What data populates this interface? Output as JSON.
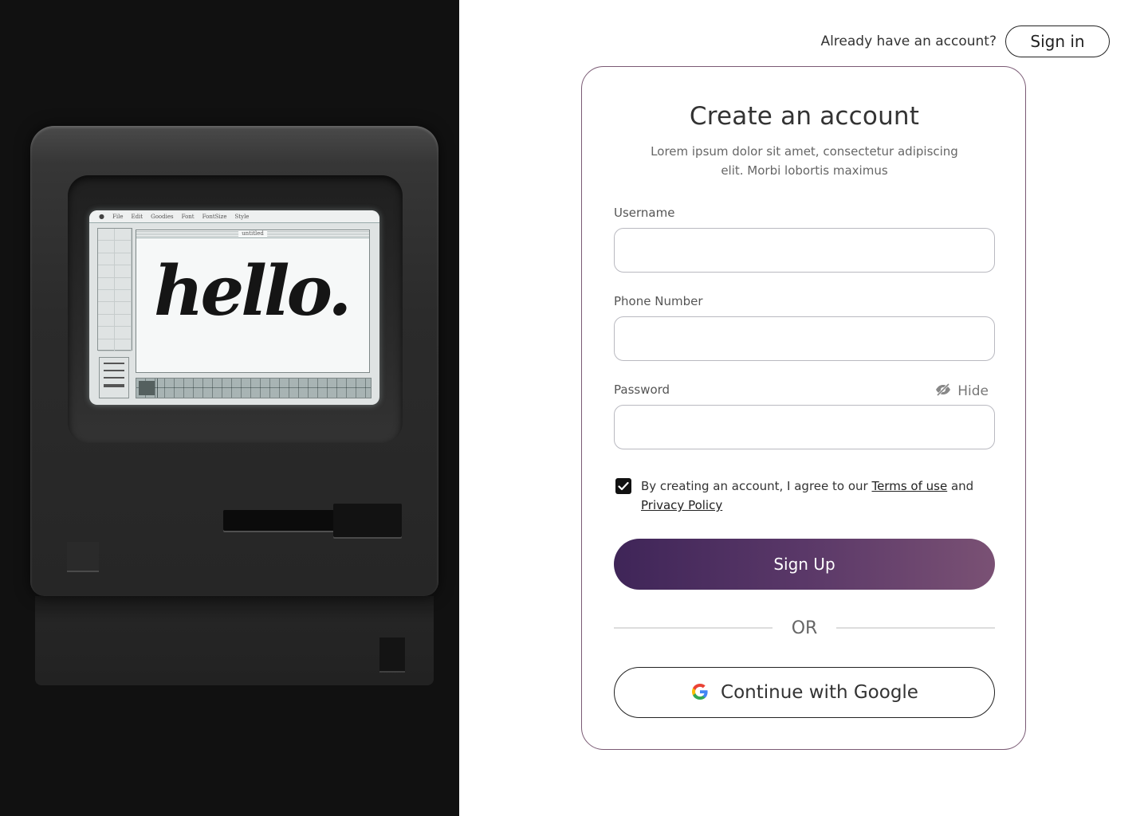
{
  "hero": {
    "screen_text": "hello.",
    "menu_items": [
      "File",
      "Edit",
      "Goodies",
      "Font",
      "FontSize",
      "Style"
    ],
    "canvas_title": "untitled"
  },
  "topbar": {
    "prompt": "Already have an account?",
    "signin_label": "Sign in"
  },
  "form": {
    "title": "Create an account",
    "subtitle": "Lorem ipsum dolor sit amet, consectetur adipiscing elit. Morbi lobortis maximus",
    "username": {
      "label": "Username",
      "value": "",
      "placeholder": ""
    },
    "phone": {
      "label": "Phone Number",
      "value": "",
      "placeholder": ""
    },
    "password": {
      "label": "Password",
      "value": "",
      "placeholder": "",
      "toggle_label": "Hide"
    },
    "terms": {
      "checked": true,
      "prefix": "By creating an account, I agree to our ",
      "terms_link": "Terms of use",
      "middle": " and ",
      "privacy_link": "Privacy Policy"
    },
    "signup_label": "Sign Up",
    "divider_label": "OR",
    "google_label": "Continue with Google"
  },
  "colors": {
    "signup_gradient_start": "#3f2558",
    "signup_gradient_end": "#7a5174",
    "hero_background": "#111111",
    "card_border": "#7a5a74"
  },
  "icons": {
    "password_toggle": "eye-slash-icon",
    "google": "google-logo-icon",
    "checkbox": "checkmark-icon"
  }
}
